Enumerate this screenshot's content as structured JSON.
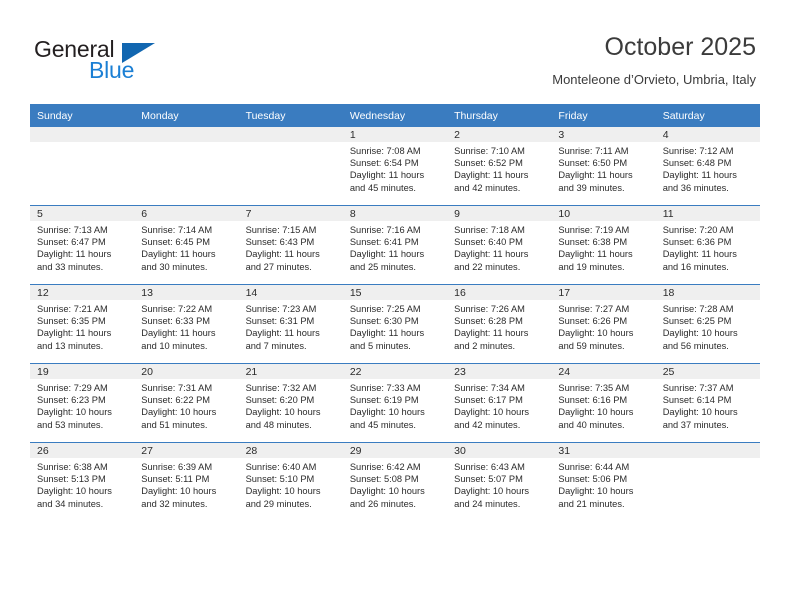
{
  "brand": {
    "word_one": "General",
    "word_two": "Blue",
    "triangle_icon": "triangle-icon",
    "dark_color": "#231f20",
    "blue_color": "#1b7fd4",
    "triangle_color": "#1166b0"
  },
  "header": {
    "title": "October 2025",
    "subtitle": "Monteleone d’Orvieto, Umbria, Italy"
  },
  "theme": {
    "header_row_bg": "#3a7cc0",
    "header_row_text": "#ffffff",
    "daynum_band_bg": "#efefef",
    "cell_border": "#3a7cc0",
    "body_text": "#2b2b2b"
  },
  "weekdays": [
    "Sunday",
    "Monday",
    "Tuesday",
    "Wednesday",
    "Thursday",
    "Friday",
    "Saturday"
  ],
  "weeks": [
    [
      {
        "day": "",
        "lines": []
      },
      {
        "day": "",
        "lines": []
      },
      {
        "day": "",
        "lines": []
      },
      {
        "day": "1",
        "lines": [
          "Sunrise: 7:08 AM",
          "Sunset: 6:54 PM",
          "Daylight: 11 hours",
          "and 45 minutes."
        ]
      },
      {
        "day": "2",
        "lines": [
          "Sunrise: 7:10 AM",
          "Sunset: 6:52 PM",
          "Daylight: 11 hours",
          "and 42 minutes."
        ]
      },
      {
        "day": "3",
        "lines": [
          "Sunrise: 7:11 AM",
          "Sunset: 6:50 PM",
          "Daylight: 11 hours",
          "and 39 minutes."
        ]
      },
      {
        "day": "4",
        "lines": [
          "Sunrise: 7:12 AM",
          "Sunset: 6:48 PM",
          "Daylight: 11 hours",
          "and 36 minutes."
        ]
      }
    ],
    [
      {
        "day": "5",
        "lines": [
          "Sunrise: 7:13 AM",
          "Sunset: 6:47 PM",
          "Daylight: 11 hours",
          "and 33 minutes."
        ]
      },
      {
        "day": "6",
        "lines": [
          "Sunrise: 7:14 AM",
          "Sunset: 6:45 PM",
          "Daylight: 11 hours",
          "and 30 minutes."
        ]
      },
      {
        "day": "7",
        "lines": [
          "Sunrise: 7:15 AM",
          "Sunset: 6:43 PM",
          "Daylight: 11 hours",
          "and 27 minutes."
        ]
      },
      {
        "day": "8",
        "lines": [
          "Sunrise: 7:16 AM",
          "Sunset: 6:41 PM",
          "Daylight: 11 hours",
          "and 25 minutes."
        ]
      },
      {
        "day": "9",
        "lines": [
          "Sunrise: 7:18 AM",
          "Sunset: 6:40 PM",
          "Daylight: 11 hours",
          "and 22 minutes."
        ]
      },
      {
        "day": "10",
        "lines": [
          "Sunrise: 7:19 AM",
          "Sunset: 6:38 PM",
          "Daylight: 11 hours",
          "and 19 minutes."
        ]
      },
      {
        "day": "11",
        "lines": [
          "Sunrise: 7:20 AM",
          "Sunset: 6:36 PM",
          "Daylight: 11 hours",
          "and 16 minutes."
        ]
      }
    ],
    [
      {
        "day": "12",
        "lines": [
          "Sunrise: 7:21 AM",
          "Sunset: 6:35 PM",
          "Daylight: 11 hours",
          "and 13 minutes."
        ]
      },
      {
        "day": "13",
        "lines": [
          "Sunrise: 7:22 AM",
          "Sunset: 6:33 PM",
          "Daylight: 11 hours",
          "and 10 minutes."
        ]
      },
      {
        "day": "14",
        "lines": [
          "Sunrise: 7:23 AM",
          "Sunset: 6:31 PM",
          "Daylight: 11 hours",
          "and 7 minutes."
        ]
      },
      {
        "day": "15",
        "lines": [
          "Sunrise: 7:25 AM",
          "Sunset: 6:30 PM",
          "Daylight: 11 hours",
          "and 5 minutes."
        ]
      },
      {
        "day": "16",
        "lines": [
          "Sunrise: 7:26 AM",
          "Sunset: 6:28 PM",
          "Daylight: 11 hours",
          "and 2 minutes."
        ]
      },
      {
        "day": "17",
        "lines": [
          "Sunrise: 7:27 AM",
          "Sunset: 6:26 PM",
          "Daylight: 10 hours",
          "and 59 minutes."
        ]
      },
      {
        "day": "18",
        "lines": [
          "Sunrise: 7:28 AM",
          "Sunset: 6:25 PM",
          "Daylight: 10 hours",
          "and 56 minutes."
        ]
      }
    ],
    [
      {
        "day": "19",
        "lines": [
          "Sunrise: 7:29 AM",
          "Sunset: 6:23 PM",
          "Daylight: 10 hours",
          "and 53 minutes."
        ]
      },
      {
        "day": "20",
        "lines": [
          "Sunrise: 7:31 AM",
          "Sunset: 6:22 PM",
          "Daylight: 10 hours",
          "and 51 minutes."
        ]
      },
      {
        "day": "21",
        "lines": [
          "Sunrise: 7:32 AM",
          "Sunset: 6:20 PM",
          "Daylight: 10 hours",
          "and 48 minutes."
        ]
      },
      {
        "day": "22",
        "lines": [
          "Sunrise: 7:33 AM",
          "Sunset: 6:19 PM",
          "Daylight: 10 hours",
          "and 45 minutes."
        ]
      },
      {
        "day": "23",
        "lines": [
          "Sunrise: 7:34 AM",
          "Sunset: 6:17 PM",
          "Daylight: 10 hours",
          "and 42 minutes."
        ]
      },
      {
        "day": "24",
        "lines": [
          "Sunrise: 7:35 AM",
          "Sunset: 6:16 PM",
          "Daylight: 10 hours",
          "and 40 minutes."
        ]
      },
      {
        "day": "25",
        "lines": [
          "Sunrise: 7:37 AM",
          "Sunset: 6:14 PM",
          "Daylight: 10 hours",
          "and 37 minutes."
        ]
      }
    ],
    [
      {
        "day": "26",
        "lines": [
          "Sunrise: 6:38 AM",
          "Sunset: 5:13 PM",
          "Daylight: 10 hours",
          "and 34 minutes."
        ]
      },
      {
        "day": "27",
        "lines": [
          "Sunrise: 6:39 AM",
          "Sunset: 5:11 PM",
          "Daylight: 10 hours",
          "and 32 minutes."
        ]
      },
      {
        "day": "28",
        "lines": [
          "Sunrise: 6:40 AM",
          "Sunset: 5:10 PM",
          "Daylight: 10 hours",
          "and 29 minutes."
        ]
      },
      {
        "day": "29",
        "lines": [
          "Sunrise: 6:42 AM",
          "Sunset: 5:08 PM",
          "Daylight: 10 hours",
          "and 26 minutes."
        ]
      },
      {
        "day": "30",
        "lines": [
          "Sunrise: 6:43 AM",
          "Sunset: 5:07 PM",
          "Daylight: 10 hours",
          "and 24 minutes."
        ]
      },
      {
        "day": "31",
        "lines": [
          "Sunrise: 6:44 AM",
          "Sunset: 5:06 PM",
          "Daylight: 10 hours",
          "and 21 minutes."
        ]
      },
      {
        "day": "",
        "lines": []
      }
    ]
  ]
}
